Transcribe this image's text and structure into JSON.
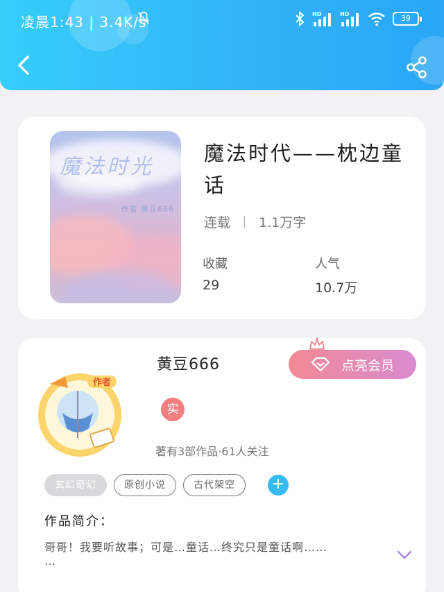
{
  "status_bar": {
    "time": "凌晨1:43 | 3.4K/s",
    "battery": "39",
    "net_badges": [
      "HD",
      "HD"
    ]
  },
  "book": {
    "cover_title": "魔法时光",
    "cover_author": "作者·黄豆666",
    "title": "魔法时代——枕边童话",
    "status": "连载",
    "word_count": "1.1万字",
    "favorites_label": "收藏",
    "favorites_value": "29",
    "popularity_label": "人气",
    "popularity_value": "10.7万"
  },
  "author": {
    "avatar_badge": "作者",
    "name": "黄豆666",
    "vip_button": "点亮会员",
    "verified_label": "实",
    "stats": "著有3部作品·61人关注",
    "tags": [
      "玄幻奇幻",
      "原创小说",
      "古代架空"
    ],
    "add_tag": "+",
    "intro_label": "作品简介：",
    "intro_text": "哥哥！我要听故事；可是…童话…终究只是童话啊……\n…"
  },
  "colors": {
    "header_start": "#36cdfb",
    "header_end": "#2aa6f5",
    "vip_start": "#f38a94",
    "vip_end": "#d88bd0",
    "verified": "#f37e80",
    "add_tag": "#37b9f2",
    "chevron": "#a78be0"
  }
}
